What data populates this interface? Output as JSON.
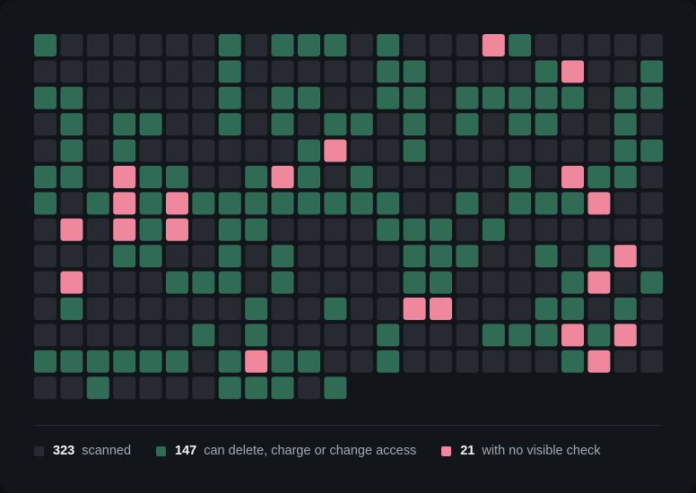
{
  "chart_data": {
    "type": "heatmap",
    "columns": 24,
    "colors": {
      "scanned": "#272a30",
      "risky": "#2f6b55",
      "unchecked": "#ef879d"
    },
    "legend": [
      {
        "key": "scanned",
        "count": "323",
        "label": "scanned"
      },
      {
        "key": "risky",
        "count": "147",
        "label": "can delete, charge or change access"
      },
      {
        "key": "unchecked",
        "count": "21",
        "label": "with no visible check"
      }
    ],
    "rows": [
      "G......G.GGG.G...PG.....",
      ".......G.....GG....GP..G",
      "GG.....G.GG..GG.GGGGG.GG",
      ".G.GG..G.G.GG.G.G.GG..G.",
      ".G.G......GP..G.......GG",
      "GG.PGG..GPG.G.....G.PGG.",
      "G.GPGPGGGGGGGG..G.GGGP..",
      ".P.PGP.GG....GGG.G......",
      "...GG..G.G....GGG..G.GP.",
      ".P...GGG.G....GG....GP.G",
      ".G......G..G..PP...GG.G.",
      "......G.G....G...GGGPGP.",
      "GGGGGG.GPGG..G......GP..",
      "..G....GGG.G"
    ]
  }
}
